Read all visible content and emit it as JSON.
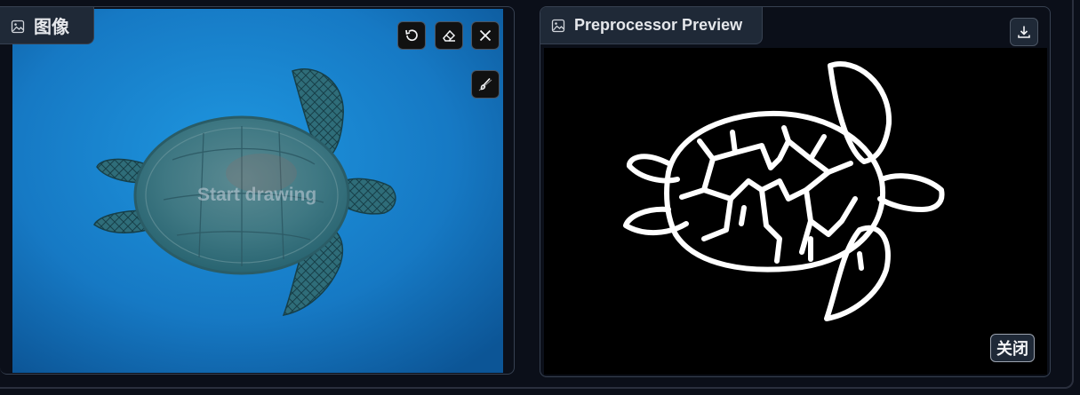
{
  "image_panel": {
    "label": "图像",
    "placeholder_text": "Start drawing",
    "tools": {
      "undo": "undo-icon",
      "erase": "eraser-icon",
      "clear": "close-icon",
      "brush": "brush-icon"
    },
    "colors": {
      "water_light": "#1d8fd8",
      "water_dark": "#0d5a9c"
    }
  },
  "preview_panel": {
    "label": "Preprocessor Preview",
    "download_icon": "download-icon",
    "close_label": "关闭"
  }
}
